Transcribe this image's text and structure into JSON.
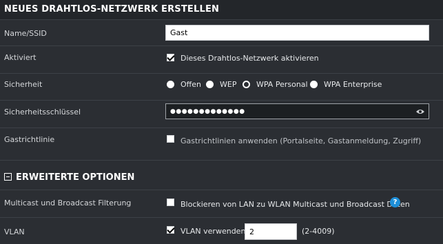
{
  "header": {
    "title": "NEUES DRAHTLOS-NETZWERK ERSTELLEN"
  },
  "fields": {
    "name": {
      "label": "Name/SSID",
      "value": "Gast"
    },
    "activated": {
      "label": "Aktiviert",
      "checkbox_label": "Dieses Drahtlos-Netzwerk aktivieren",
      "checked": true
    },
    "security": {
      "label": "Sicherheit",
      "options": [
        "Offen",
        "WEP",
        "WPA Personal",
        "WPA Enterprise"
      ],
      "selected": "WPA Personal"
    },
    "key": {
      "label": "Sicherheitsschlüssel",
      "value": "●●●●●●●●●●●●●",
      "icon": "eye-icon"
    },
    "guest_policy": {
      "label": "Gastrichtlinie",
      "checkbox_label": "Gastrichtlinien anwenden (Portalseite, Gastanmeldung, Zugriff)",
      "checked": false
    }
  },
  "advanced": {
    "title": "ERWEITERTE OPTIONEN",
    "multicast": {
      "label": "Multicast und Broadcast Filterung",
      "checkbox_label": "Blockieren von LAN zu WLAN Multicast und Broadcast Daten",
      "checked": false,
      "help": "?"
    },
    "vlan": {
      "label": "VLAN",
      "checkbox_label": "VLAN verwenden",
      "checked": true,
      "value": "2",
      "range": "(2-4009)"
    }
  }
}
